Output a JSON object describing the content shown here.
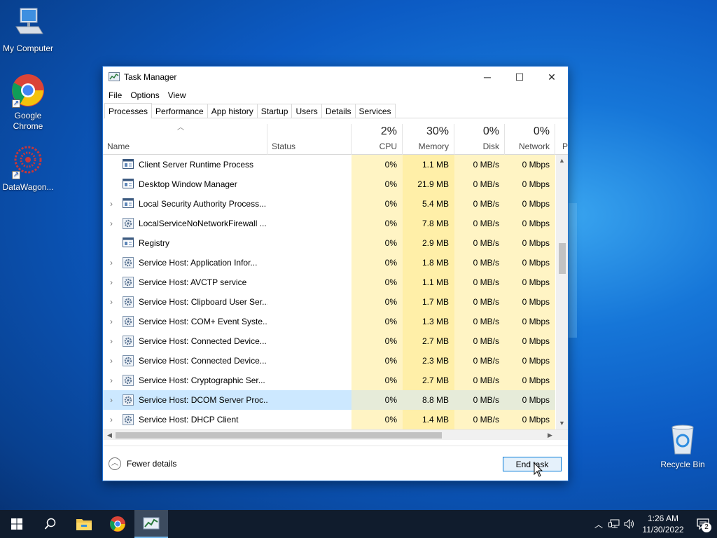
{
  "desktop": {
    "icons": [
      {
        "label": "My Computer",
        "icon": "computer-icon"
      },
      {
        "label": "Google Chrome",
        "icon": "chrome-icon"
      },
      {
        "label": "DataWagon...",
        "icon": "datawagon-icon"
      },
      {
        "label": "Recycle Bin",
        "icon": "recycle-bin-icon"
      }
    ]
  },
  "window": {
    "title": "Task Manager",
    "controls": {
      "minimize": "─",
      "maximize": "☐",
      "close": "✕"
    },
    "menu": [
      "File",
      "Options",
      "View"
    ],
    "tabs": [
      "Processes",
      "Performance",
      "App history",
      "Startup",
      "Users",
      "Details",
      "Services"
    ],
    "active_tab": "Processes",
    "columns": {
      "name": "Name",
      "status": "Status",
      "cpu": {
        "pct": "2%",
        "label": "CPU"
      },
      "memory": {
        "pct": "30%",
        "label": "Memory"
      },
      "disk": {
        "pct": "0%",
        "label": "Disk"
      },
      "network": {
        "pct": "0%",
        "label": "Network"
      },
      "power": "P"
    },
    "rows": [
      {
        "name": "Client Server Runtime Process",
        "expand": "",
        "icon": "window-icon",
        "cpu": "0%",
        "mem": "1.1 MB",
        "disk": "0 MB/s",
        "net": "0 Mbps"
      },
      {
        "name": "Desktop Window Manager",
        "expand": "",
        "icon": "window-icon",
        "cpu": "0%",
        "mem": "21.9 MB",
        "disk": "0 MB/s",
        "net": "0 Mbps"
      },
      {
        "name": "Local Security Authority Process...",
        "expand": ">",
        "icon": "window-icon",
        "cpu": "0%",
        "mem": "5.4 MB",
        "disk": "0 MB/s",
        "net": "0 Mbps"
      },
      {
        "name": "LocalServiceNoNetworkFirewall ...",
        "expand": ">",
        "icon": "gear-icon",
        "cpu": "0%",
        "mem": "7.8 MB",
        "disk": "0 MB/s",
        "net": "0 Mbps"
      },
      {
        "name": "Registry",
        "expand": "",
        "icon": "window-icon",
        "cpu": "0%",
        "mem": "2.9 MB",
        "disk": "0 MB/s",
        "net": "0 Mbps"
      },
      {
        "name": "Service Host: Application Infor...",
        "expand": ">",
        "icon": "gear-icon",
        "cpu": "0%",
        "mem": "1.8 MB",
        "disk": "0 MB/s",
        "net": "0 Mbps"
      },
      {
        "name": "Service Host: AVCTP service",
        "expand": ">",
        "icon": "gear-icon",
        "cpu": "0%",
        "mem": "1.1 MB",
        "disk": "0 MB/s",
        "net": "0 Mbps"
      },
      {
        "name": "Service Host: Clipboard User Ser...",
        "expand": ">",
        "icon": "gear-icon",
        "cpu": "0%",
        "mem": "1.7 MB",
        "disk": "0 MB/s",
        "net": "0 Mbps"
      },
      {
        "name": "Service Host: COM+ Event Syste...",
        "expand": ">",
        "icon": "gear-icon",
        "cpu": "0%",
        "mem": "1.3 MB",
        "disk": "0 MB/s",
        "net": "0 Mbps"
      },
      {
        "name": "Service Host: Connected Device...",
        "expand": ">",
        "icon": "gear-icon",
        "cpu": "0%",
        "mem": "2.7 MB",
        "disk": "0 MB/s",
        "net": "0 Mbps"
      },
      {
        "name": "Service Host: Connected Device...",
        "expand": ">",
        "icon": "gear-icon",
        "cpu": "0%",
        "mem": "2.3 MB",
        "disk": "0 MB/s",
        "net": "0 Mbps"
      },
      {
        "name": "Service Host: Cryptographic Ser...",
        "expand": ">",
        "icon": "gear-icon",
        "cpu": "0%",
        "mem": "2.7 MB",
        "disk": "0 MB/s",
        "net": "0 Mbps"
      },
      {
        "name": "Service Host: DCOM Server Proc...",
        "expand": ">",
        "icon": "gear-icon",
        "cpu": "0%",
        "mem": "8.8 MB",
        "disk": "0 MB/s",
        "net": "0 Mbps",
        "selected": true
      },
      {
        "name": "Service Host: DHCP Client",
        "expand": ">",
        "icon": "gear-icon",
        "cpu": "0%",
        "mem": "1.4 MB",
        "disk": "0 MB/s",
        "net": "0 Mbps"
      }
    ],
    "footer": {
      "fewer_details": "Fewer details",
      "end_task": "End task"
    }
  },
  "taskbar": {
    "items": [
      "start-icon",
      "search-icon",
      "file-explorer-icon",
      "chrome-icon",
      "task-manager-icon"
    ],
    "active": "task-manager-icon",
    "clock": {
      "time": "1:26 AM",
      "date": "11/30/2022"
    },
    "notifications": "2"
  }
}
